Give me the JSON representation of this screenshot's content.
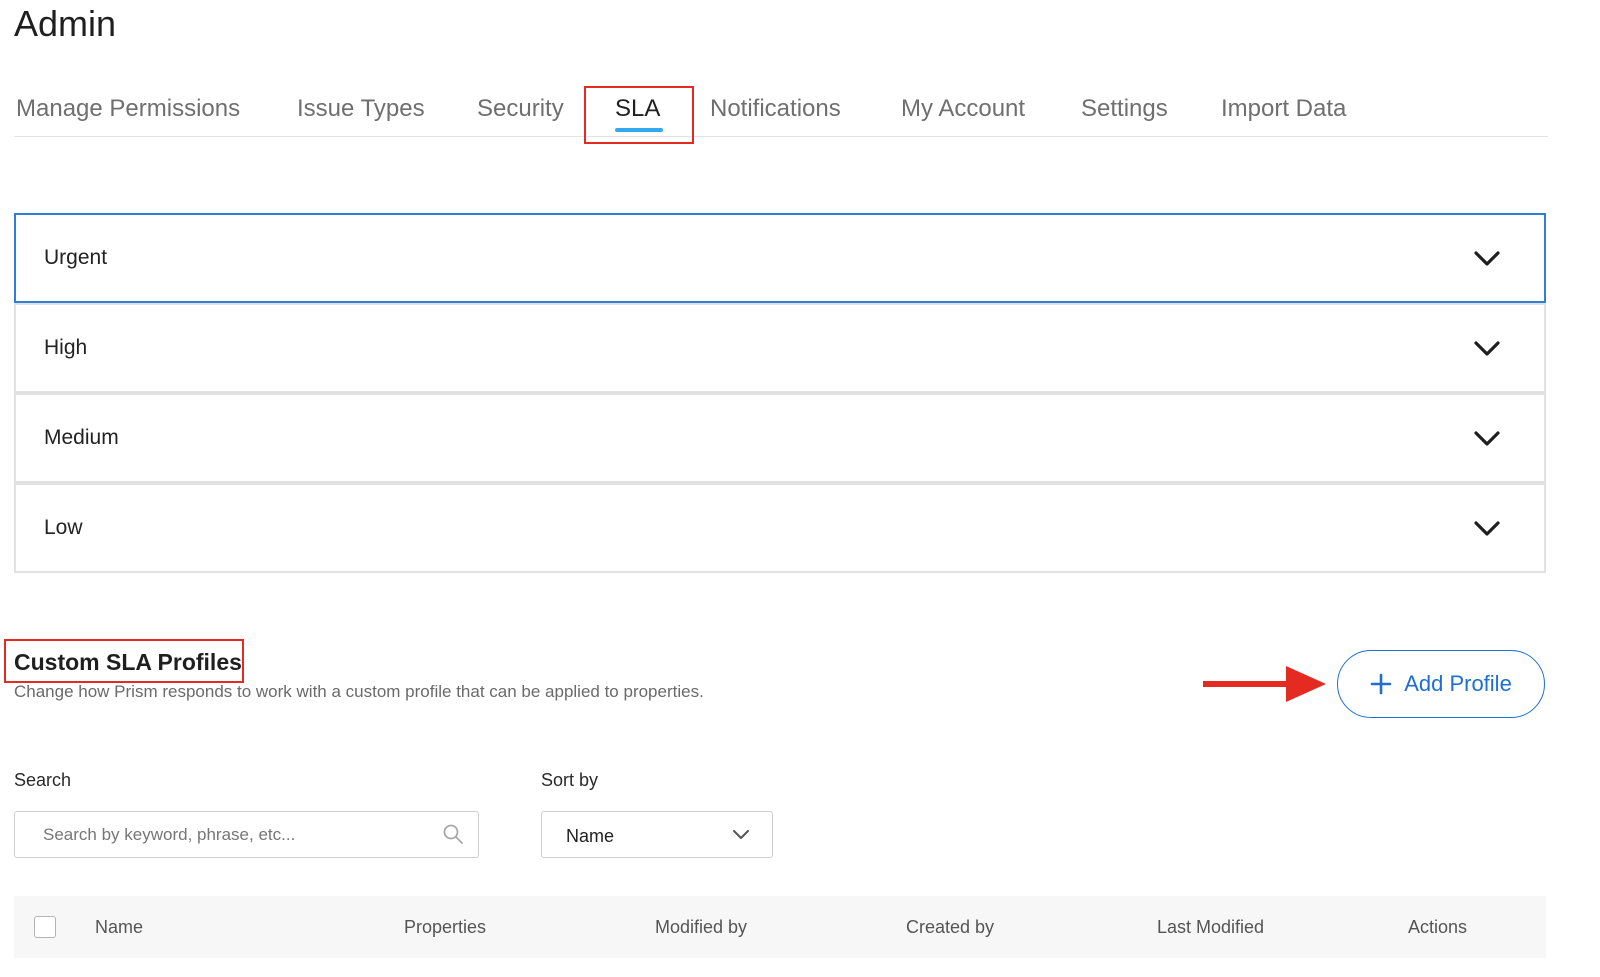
{
  "page": {
    "title": "Admin"
  },
  "tabs": [
    {
      "label": "Manage Permissions"
    },
    {
      "label": "Issue Types"
    },
    {
      "label": "Security"
    },
    {
      "label": "SLA",
      "active": true
    },
    {
      "label": "Notifications"
    },
    {
      "label": "My Account"
    },
    {
      "label": "Settings"
    },
    {
      "label": "Import Data"
    }
  ],
  "priorities": [
    {
      "label": "Urgent",
      "icon": "chevron-down-icon"
    },
    {
      "label": "High",
      "icon": "chevron-down-icon"
    },
    {
      "label": "Medium",
      "icon": "chevron-down-icon"
    },
    {
      "label": "Low",
      "icon": "chevron-down-icon"
    }
  ],
  "custom_profiles": {
    "title": "Custom SLA Profiles",
    "subtitle": "Change how Prism responds to work with a custom profile that can be applied to properties.",
    "add_button_label": "Add Profile",
    "add_button_icon": "plus-icon"
  },
  "filters": {
    "search_label": "Search",
    "search_placeholder": "Search by keyword, phrase, etc...",
    "search_icon": "search-icon",
    "sort_label": "Sort by",
    "sort_value": "Name"
  },
  "table": {
    "columns": [
      "Name",
      "Properties",
      "Modified by",
      "Created by",
      "Last Modified",
      "Actions"
    ]
  },
  "colors": {
    "accent_blue": "#1f6fd1",
    "tab_underline": "#35a9f0",
    "annotation_red": "#e32b22",
    "focus_border": "#2f7fd6"
  }
}
